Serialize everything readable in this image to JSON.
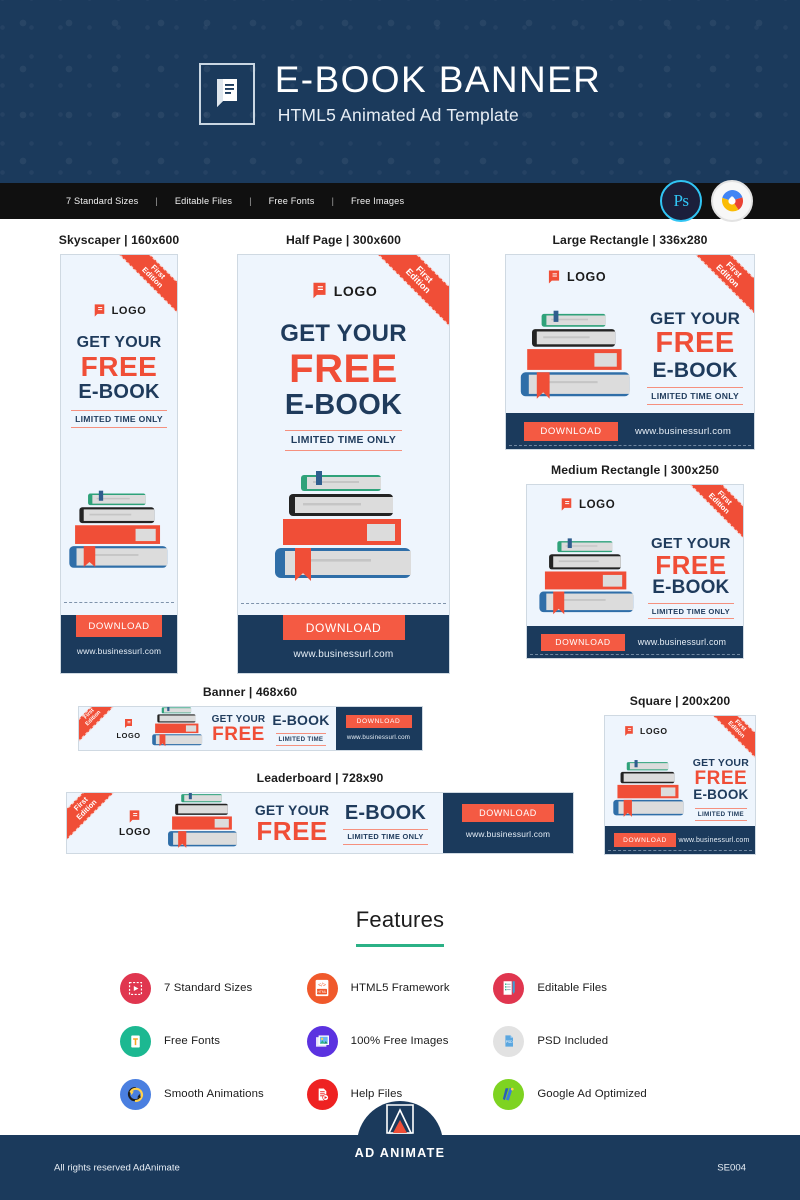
{
  "hero": {
    "logo_icon": "book-icon",
    "title": "E-BOOK BANNER",
    "subtitle": "HTML5 Animated Ad Template"
  },
  "feature_bar": {
    "items": [
      "7 Standard Sizes",
      "Editable Files",
      "Free Fonts",
      "Free Images"
    ],
    "separator": "|",
    "badges": [
      {
        "name": "photoshop-badge",
        "label": "Ps"
      },
      {
        "name": "google-badge",
        "label": ""
      }
    ]
  },
  "ad_common": {
    "ribbon_line1": "First",
    "ribbon_line2": "Edition",
    "logo_word": "LOGO",
    "headline1": "GET YOUR",
    "headline2": "FREE",
    "headline3": "E-BOOK",
    "limited": "LIMITED TIME ONLY",
    "limited_short": "LIMITED TIME",
    "download": "DOWNLOAD",
    "url": "www.businessurl.com"
  },
  "banners": [
    {
      "key": "skyscraper",
      "label": "Skyscaper | 160x600"
    },
    {
      "key": "halfpage",
      "label": "Half Page | 300x600"
    },
    {
      "key": "large_rectangle",
      "label": "Large Rectangle | 336x280"
    },
    {
      "key": "medium_rectangle",
      "label": "Medium Rectangle | 300x250"
    },
    {
      "key": "banner",
      "label": "Banner | 468x60"
    },
    {
      "key": "leaderboard",
      "label": "Leaderboard | 728x90"
    },
    {
      "key": "square",
      "label": "Square | 200x200"
    }
  ],
  "features": {
    "title": "Features",
    "items": [
      {
        "icon": "sizes-icon",
        "label": "7 Standard Sizes",
        "color": "#e0364f"
      },
      {
        "icon": "html5-icon",
        "label": "HTML5 Framework",
        "color": "#f0592b"
      },
      {
        "icon": "editable-icon",
        "label": "Editable Files",
        "color": "#e0364f"
      },
      {
        "icon": "fonts-icon",
        "label": "Free Fonts",
        "color": "#1cb891"
      },
      {
        "icon": "images-icon",
        "label": "100% Free Images",
        "color": "#5b32e0"
      },
      {
        "icon": "psd-icon",
        "label": "PSD Included",
        "color": "#e2e2e2"
      },
      {
        "icon": "animations-icon",
        "label": "Smooth Animations",
        "color": "#4a7fe0"
      },
      {
        "icon": "help-icon",
        "label": "Help Files",
        "color": "#ee2222"
      },
      {
        "icon": "googlead-icon",
        "label": "Google Ad Optimized",
        "color": "#7ed321"
      }
    ]
  },
  "footer": {
    "copyright": "All rights reserved AdAnimate",
    "code": "SE004",
    "brand": "AD ANIMATE",
    "brand_icon": "ad-animate-logo"
  },
  "colors": {
    "navy": "#1b3a5c",
    "red": "#f04e37",
    "light_blue_bg": "#eef5fd",
    "dark_bar": "#101010"
  }
}
